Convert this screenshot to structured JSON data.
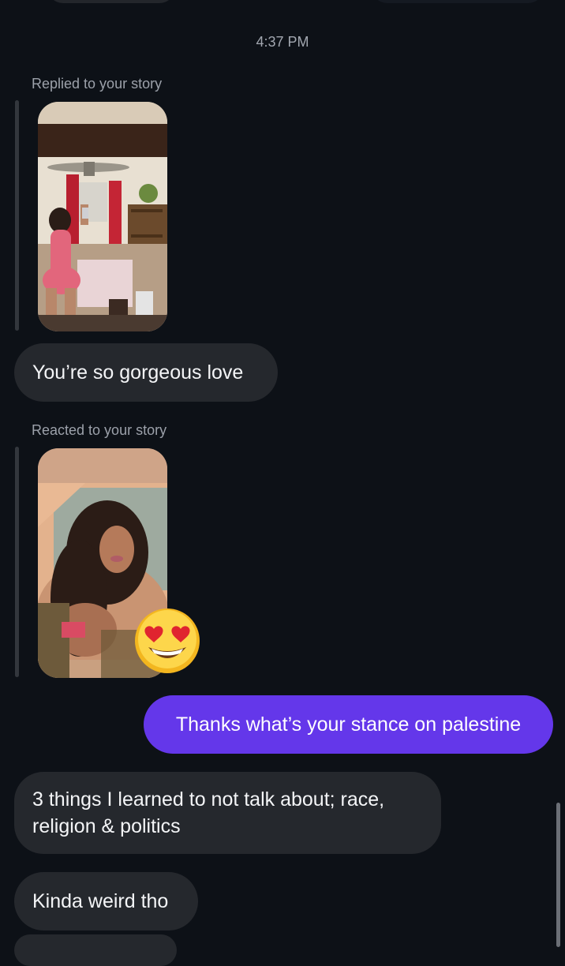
{
  "conversation": {
    "timestamp": "4:37 PM",
    "messages": [
      {
        "id": "story-reply",
        "story_label": "Replied to your story",
        "story_photo": "mirror-selfie-photo",
        "text": "You’re so gorgeous love"
      },
      {
        "id": "story-reaction",
        "story_label": "Reacted to your story",
        "story_photo": "selfie-photo",
        "reaction_emoji": "😍"
      },
      {
        "id": "sent-1",
        "direction": "sent",
        "text": "Thanks what’s your stance on palestine"
      },
      {
        "id": "received-2",
        "direction": "received",
        "line1": "3 things I learned to not talk about; race,",
        "line2": "religion & politics"
      },
      {
        "id": "received-3",
        "direction": "received",
        "text": "Kinda weird tho"
      }
    ]
  },
  "colors": {
    "background": "#0d1117",
    "received_bubble": "#25282d",
    "sent_bubble": "#6437ea",
    "secondary_text": "#9ca1aa"
  }
}
